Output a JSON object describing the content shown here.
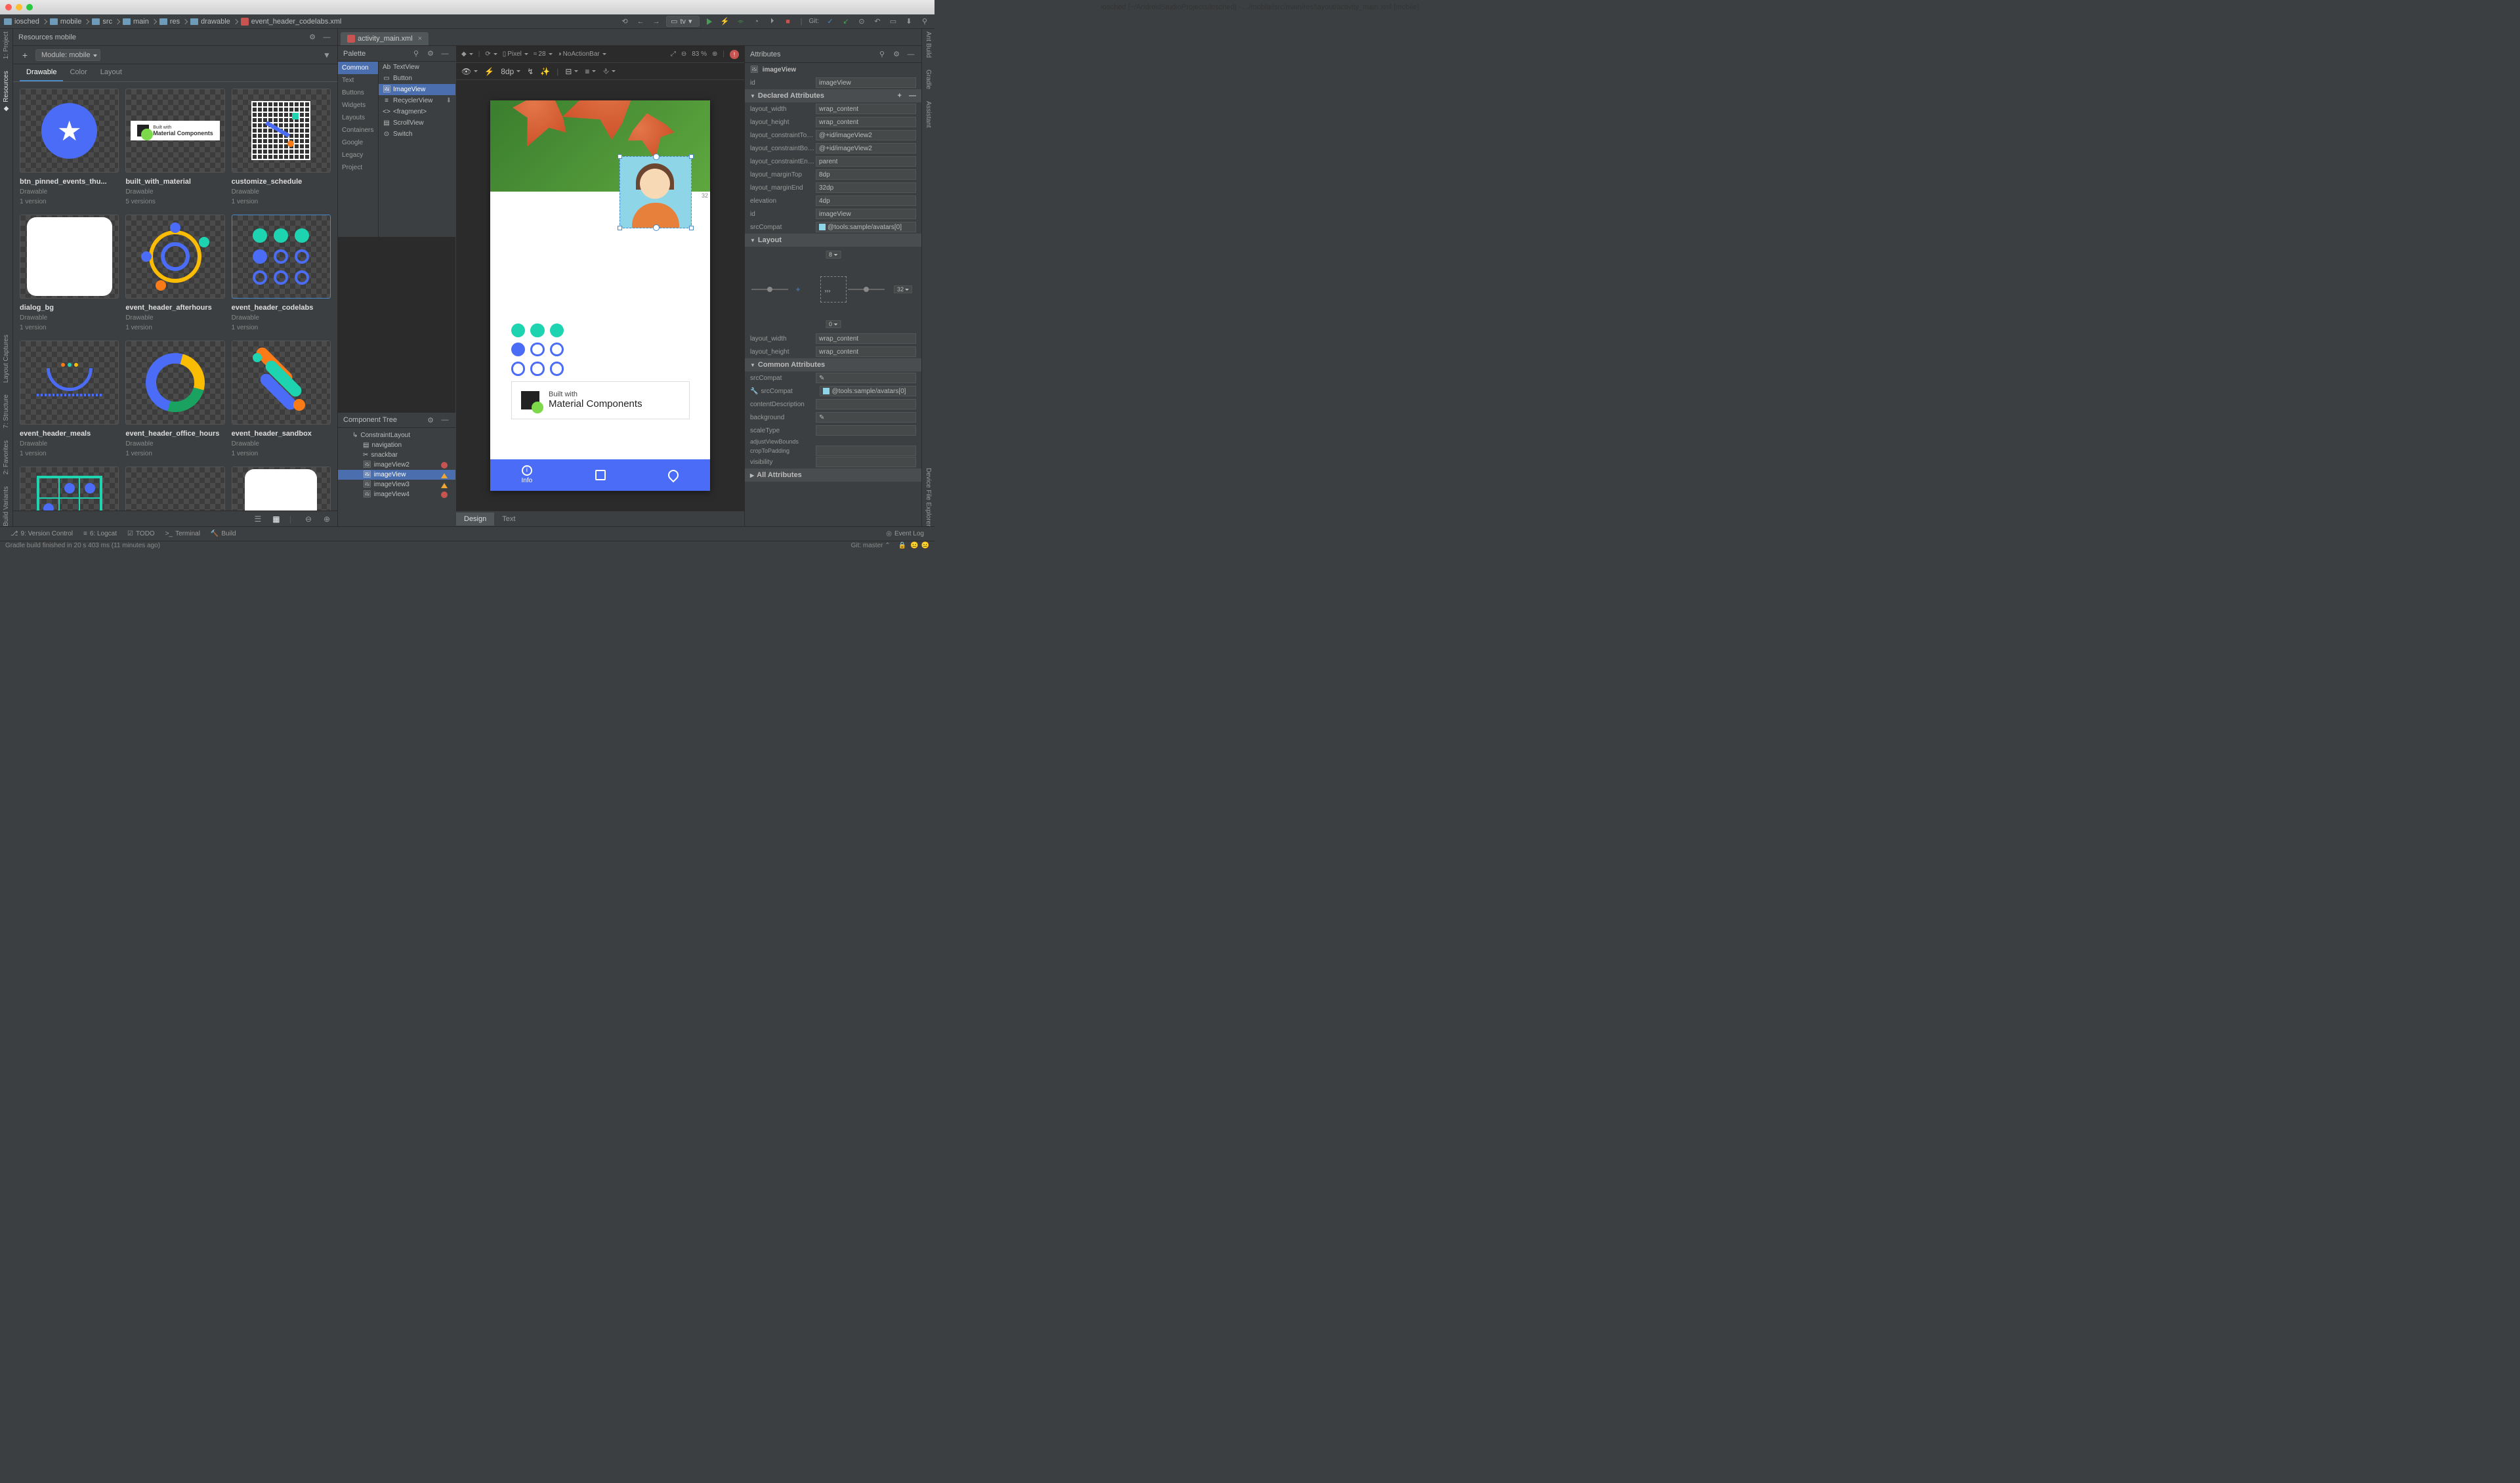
{
  "window": {
    "title": "iosched [~/AndroidStudioProjects/iosched] - .../mobile/src/main/res/layout/activity_main.xml [mobile]"
  },
  "breadcrumbs": [
    "iosched",
    "mobile",
    "src",
    "main",
    "res",
    "drawable",
    "event_header_codelabs.xml"
  ],
  "toolbar": {
    "device": "tv"
  },
  "resources": {
    "title": "Resources  mobile",
    "module": "Module: mobile",
    "tabs": {
      "drawable": "Drawable",
      "color": "Color",
      "layout": "Layout"
    },
    "items": [
      {
        "name": "btn_pinned_events_thu...",
        "type": "Drawable",
        "versions": "1 version"
      },
      {
        "name": "built_with_material",
        "type": "Drawable",
        "versions": "5 versions"
      },
      {
        "name": "customize_schedule",
        "type": "Drawable",
        "versions": "1 version"
      },
      {
        "name": "dialog_bg",
        "type": "Drawable",
        "versions": "1 version"
      },
      {
        "name": "event_header_afterhours",
        "type": "Drawable",
        "versions": "1 version"
      },
      {
        "name": "event_header_codelabs",
        "type": "Drawable",
        "versions": "1 version"
      },
      {
        "name": "event_header_meals",
        "type": "Drawable",
        "versions": "1 version"
      },
      {
        "name": "event_header_office_hours",
        "type": "Drawable",
        "versions": "1 version"
      },
      {
        "name": "event_header_sandbox",
        "type": "Drawable",
        "versions": "1 version"
      }
    ]
  },
  "editor": {
    "tab": "activity_main.xml",
    "bottomTabs": {
      "design": "Design",
      "text": "Text"
    }
  },
  "palette": {
    "title": "Palette",
    "cats": [
      "Common",
      "Text",
      "Buttons",
      "Widgets",
      "Layouts",
      "Containers",
      "Google",
      "Legacy",
      "Project"
    ],
    "items": [
      "TextView",
      "Button",
      "ImageView",
      "RecyclerView",
      "<fragment>",
      "ScrollView",
      "Switch"
    ]
  },
  "ctree": {
    "title": "Component Tree",
    "root": "ConstraintLayout",
    "children": [
      "navigation",
      "snackbar",
      "imageView2",
      "imageView",
      "imageView3",
      "imageView4"
    ]
  },
  "canvas": {
    "device": "Pixel",
    "api": "28",
    "theme": "NoActionBar",
    "zoom": "83 %",
    "margin8": "8dp",
    "bwm_small": "Built with",
    "bwm_big": "Material Components",
    "bottom_nav": "Info",
    "avatar_margin": "32"
  },
  "attrs": {
    "title": "Attributes",
    "component": "imageView",
    "id_label": "id",
    "id_value": "imageView",
    "sections": {
      "declared": "Declared Attributes",
      "layout": "Layout",
      "common": "Common Attributes",
      "all": "All Attributes"
    },
    "rows": {
      "layout_width": "wrap_content",
      "layout_height": "wrap_content",
      "top_to": "@+id/imageView2",
      "bottom_to": "@+id/imageView2",
      "end_to": "parent",
      "marginTop": "8dp",
      "marginEnd": "32dp",
      "elevation": "4dp",
      "id2": "imageView",
      "srcCompat": "@tools:sample/avatars[0]"
    },
    "labels": {
      "layout_width": "layout_width",
      "layout_height": "layout_height",
      "top_to": "layout_constraintTop_toTopOf",
      "bottom_to": "layout_constraintBottom_toBottomOf",
      "end_to": "layout_constraintEnd_toEndOf",
      "marginTop": "layout_marginTop",
      "marginEnd": "layout_marginEnd",
      "elevation": "elevation",
      "id": "id",
      "srcCompat": "srcCompat",
      "srcCompat2": "srcCompat",
      "contentDescription": "contentDescription",
      "background": "background",
      "scaleType": "scaleType",
      "adjustViewBounds": "adjustViewBounds",
      "cropToPadding": "cropToPadding",
      "visibility": "visibility"
    },
    "layoutNums": {
      "top": "8",
      "right": "32",
      "bottom": "0"
    },
    "layout2": {
      "width": "wrap_content",
      "height": "wrap_content"
    },
    "common": {
      "srcCompat2": "@tools:sample/avatars[0]"
    }
  },
  "bottom": {
    "tools": {
      "vc": "9: Version Control",
      "logcat": "6: Logcat",
      "todo": "TODO",
      "terminal": "Terminal",
      "build": "Build"
    },
    "event": "Event Log",
    "git": "Git: master",
    "msg": "Gradle build finished in 20 s 403 ms (11 minutes ago)"
  },
  "sideTabs": {
    "left": [
      "1: Project",
      "Resources"
    ],
    "leftBottom": [
      "Layout Captures",
      "7: Structure",
      "2: Favorites",
      "Build Variants"
    ],
    "right": [
      "Ant Build",
      "Gradle",
      "Assistant"
    ],
    "rightBottom": [
      "Device File Explorer"
    ]
  }
}
